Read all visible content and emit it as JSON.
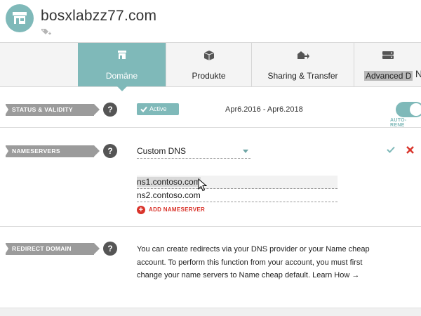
{
  "header": {
    "domain": "bosxlabzz77.com"
  },
  "tabs": [
    {
      "label": "Domäne",
      "icon": "store-icon",
      "active": true
    },
    {
      "label": "Produkte",
      "icon": "box-icon",
      "active": false
    },
    {
      "label": "Sharing & Transfer",
      "icon": "share-transfer-icon",
      "active": false
    },
    {
      "label": "Advanced D",
      "icon": "server-icon",
      "active": false
    }
  ],
  "tab_overflow": "N",
  "status": {
    "ribbon": "STATUS & VALIDITY",
    "help": "?",
    "badge": "Active",
    "dates": "Apr6.2016 - Apr6.2018",
    "auto_renew": "AUTO-RENE"
  },
  "nameservers": {
    "ribbon": "NAMESERVERS",
    "help": "?",
    "dns_type": "Custom DNS",
    "ns1": "ns1.contoso.com",
    "ns2": "ns2.contoso.com",
    "add_label": "ADD NAMESERVER",
    "add_plus": "+"
  },
  "redirect": {
    "ribbon": "REDIRECT DOMAIN",
    "help": "?",
    "line1": "You can create redirects via your DNS provider or your Name cheap",
    "line2": "account. To perform this function from your account, you must first",
    "line3": "change your name servers to Name cheap default. Learn How →"
  },
  "colors": {
    "accent": "#7fb9b9",
    "ribbon": "#9b9b9b",
    "danger": "#d9342b"
  }
}
